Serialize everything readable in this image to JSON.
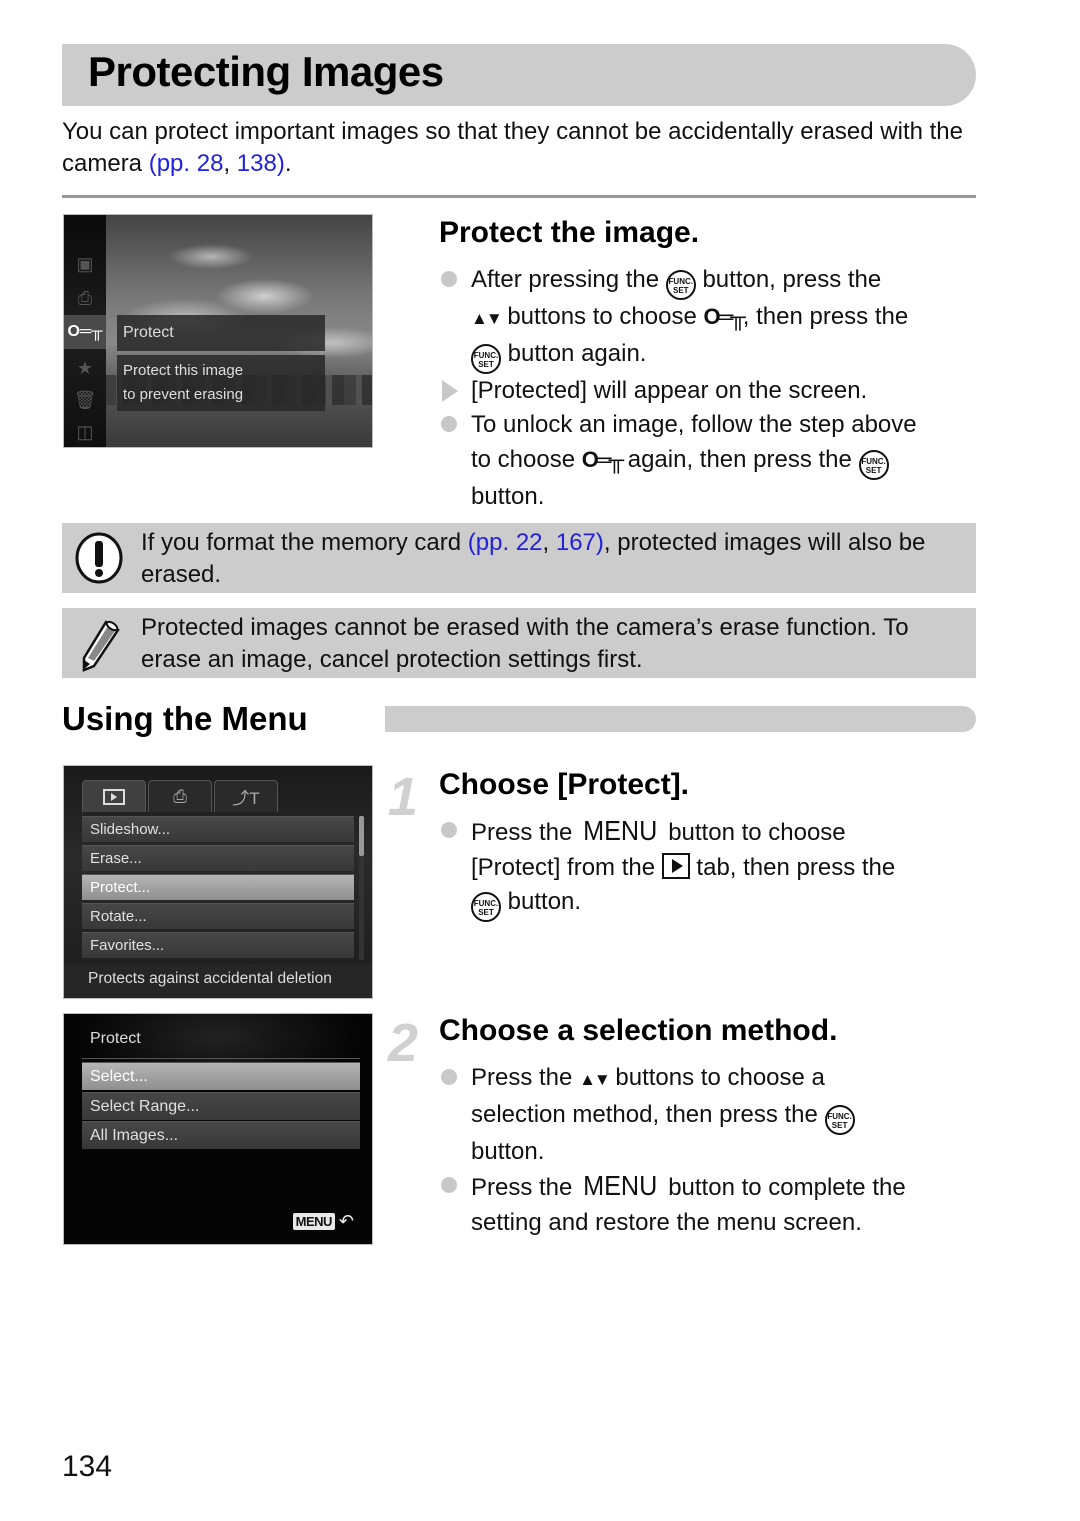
{
  "page": {
    "title": "Protecting Images",
    "intro": {
      "text": "You can protect important images so that they cannot be accidentally erased with the camera ",
      "link_open": "(pp. ",
      "link1": "28",
      "sep": ", ",
      "link2": "138",
      "link_close": ")",
      "end": "."
    },
    "page_number": "134"
  },
  "protect_image": {
    "heading": "Protect the image.",
    "bullets": [
      {
        "type": "dot",
        "parts": [
          "After pressing the",
          "button, press the",
          "buttons to choose",
          ", then press the",
          "button again."
        ]
      },
      {
        "type": "arrow",
        "text": "[Protected] will appear on the screen."
      },
      {
        "type": "dot",
        "parts": [
          "To unlock an image, follow the step above",
          "to choose",
          "again, then press the",
          "button."
        ]
      }
    ],
    "screen": {
      "side_icons": [
        "image-effect-icon",
        "print-icon",
        "protect-key-icon",
        "favorite-star-icon",
        "erase-trash-icon",
        "transfer-icon"
      ],
      "selected_icon": "protect-key-icon",
      "popup_title": "Protect",
      "popup_desc_line1": "Protect this image",
      "popup_desc_line2": "to prevent erasing"
    }
  },
  "notes": {
    "caution": {
      "text_before": "If you format the memory card ",
      "link_open": "(pp. ",
      "link1": "22",
      "sep": ", ",
      "link2": "167",
      "link_close": ")",
      "text_after": ", protected images will also be erased."
    },
    "memo": {
      "text": "Protected images cannot be erased with the camera’s erase function. To erase an image, cancel protection settings first."
    }
  },
  "using_menu": {
    "heading": "Using the Menu",
    "step1": {
      "number": "1",
      "heading": "Choose [Protect].",
      "parts": [
        "Press the",
        "MENU",
        "button to choose",
        "[Protect] from the",
        "tab, then press the",
        "button."
      ]
    },
    "step2": {
      "number": "2",
      "heading": "Choose a selection method.",
      "bullet1": [
        "Press the",
        "buttons to choose a",
        "selection method, then press the",
        "button."
      ],
      "bullet2": [
        "Press the",
        "MENU",
        "button to complete the",
        "setting and restore the menu screen."
      ]
    },
    "menu_screen": {
      "tabs": [
        "playback-tab",
        "print-tab",
        "settings-tab"
      ],
      "active_tab": "playback-tab",
      "items": [
        "Slideshow...",
        "Erase...",
        "Protect...",
        "Rotate...",
        "Favorites..."
      ],
      "selected_item": "Protect...",
      "hint": "Protects against accidental deletion"
    },
    "protect_screen": {
      "title": "Protect",
      "items": [
        "Select...",
        "Select Range...",
        "All Images..."
      ],
      "selected_item": "Select...",
      "menu_button": "MENU",
      "return_glyph": "⮌"
    }
  },
  "glyphs": {
    "func_top": "FUNC.",
    "func_bottom": "SET",
    "updown": "▲▼",
    "key": "O═╥",
    "menu_word": "MENU"
  },
  "colors": {
    "link": "#2222dd",
    "band": "#cccccc",
    "bullet": "#c8c8c8"
  }
}
